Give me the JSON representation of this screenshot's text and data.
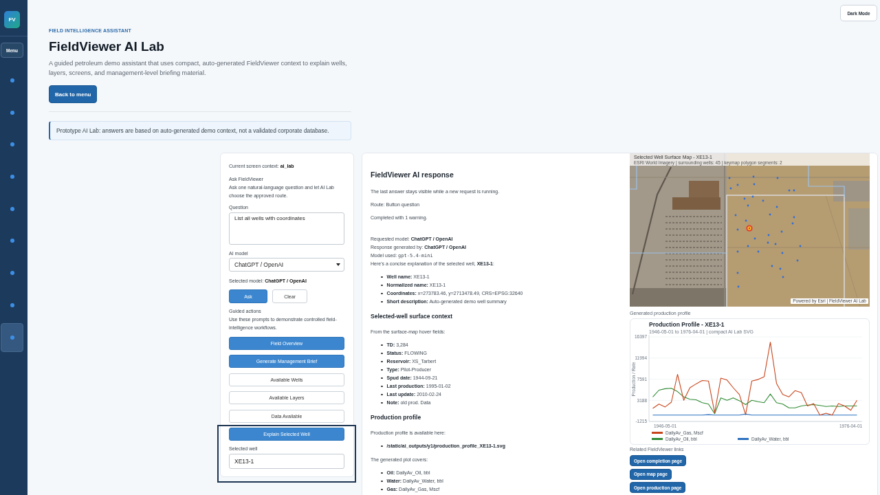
{
  "sidebar": {
    "logo": "FV",
    "menu_button": "Menu",
    "items": [
      {
        "selected": false
      },
      {
        "selected": false
      },
      {
        "selected": false
      },
      {
        "selected": false
      },
      {
        "selected": false
      },
      {
        "selected": false
      },
      {
        "selected": false
      },
      {
        "selected": false
      },
      {
        "selected": true
      }
    ]
  },
  "top_bar": {
    "dark_mode_button": "Dark Mode"
  },
  "header": {
    "kicker": "FIELD INTELLIGENCE ASSISTANT",
    "title": "FieldViewer AI Lab",
    "description": "A guided petroleum demo assistant that uses compact, auto-generated FieldViewer context to explain wells, layers, screens, and management-level briefing material.",
    "back_button": "Back to menu",
    "notice": "Prototype AI Lab: answers are based on auto-generated demo context, not a validated corporate database."
  },
  "ask_panel": {
    "context": "Current screen context: **ai_lab**",
    "heading": "Ask FieldViewer",
    "description": "Ask one natural-language question and let AI Lab choose the approved route.",
    "question": {
      "label": "Question",
      "value": "List all wells with coordinates"
    },
    "model": {
      "label": "AI model",
      "value": "ChatGPT / OpenAI"
    },
    "selected_model": "Selected model: **ChatGPT / OpenAI**",
    "buttons": [
      {
        "label": "Ask",
        "kind": "primary"
      },
      {
        "label": "Clear",
        "kind": "secondary"
      }
    ],
    "guided": {
      "heading": "Guided actions",
      "description": "Use these prompts to demonstrate controlled field-intelligence workflows.",
      "actions": [
        {
          "label": "Field Overview",
          "kind": "primary"
        },
        {
          "label": "Generate Management Brief",
          "kind": "primary"
        },
        {
          "label": "Available Wells",
          "kind": "secondary"
        },
        {
          "label": "Available Layers",
          "kind": "secondary"
        },
        {
          "label": "Data Available",
          "kind": "secondary"
        }
      ]
    },
    "focus_group": {
      "highlighted": true,
      "action": {
        "label": "Explain Selected Well",
        "kind": "primary"
      },
      "selected_well": {
        "label": "Selected well",
        "value": "XE13-1"
      }
    }
  },
  "response": {
    "title": "FieldViewer AI response",
    "status_lines": [
      "The last answer stays visible while a new request is running.",
      "Route: Button question",
      "Completed with 1 warning."
    ],
    "meta_lines": [
      "Requested model: **ChatGPT / OpenAI**",
      "Response generated by: **ChatGPT / OpenAI**"
    ],
    "model_used": {
      "label": "Model used:",
      "value": "gpt-5.4-mini"
    },
    "intro": "Here's a concise explanation of the selected well, **XE13-1**:",
    "well_facts": [
      "**Well name:** XE13-1",
      "**Normalized name:** XE13-1",
      "**Coordinates:** x=273783.46, y=2713478.49, CRS=EPSG:32640",
      "**Short description:** Auto-generated demo well summary"
    ],
    "sections": [
      {
        "heading": "Selected-well surface context",
        "blocks": [
          {
            "kind": "paragraph",
            "text": "From the surface-map hover fields:"
          },
          {
            "kind": "list",
            "items": [
              "**TD:** 3,284",
              "**Status:** FLOWING",
              "**Reservoir:** XS_Tarbert",
              "**Type:** Pilot-Producer",
              "**Spud date:** 1944-09-21",
              "**Last production:** 1995-01-02",
              "**Last update:** 2010-02-24",
              "**Note:** old prod. Data"
            ]
          }
        ]
      },
      {
        "heading": "Production profile",
        "blocks": [
          {
            "kind": "paragraph",
            "text": "Production profile is available here:"
          },
          {
            "kind": "list",
            "bold": true,
            "items": [
              "/static/ai_outputs/y1/production_profile_XE13-1.svg"
            ]
          },
          {
            "kind": "paragraph",
            "text": "The generated plot covers:"
          },
          {
            "kind": "list",
            "items": [
              "**Oil:** DailyAv_Oil, bbl",
              "**Water:** DailyAv_Water, bbl",
              "**Gas:** DailyAv_Gas, Mscf"
            ]
          }
        ]
      }
    ],
    "surface_map": {
      "title": "Selected Well Surface Map - XE13-1",
      "subtitle": "ESRI World Imagery | surrounding wells: 45 | keymap polygon segments: 2",
      "attribution": "Powered by Esri | FieldViewer AI Lab"
    },
    "production_profile": {
      "caption": "Generated production profile",
      "subtitle": "1946-05-01 to 1976-04-01 | compact AI Lab SVG",
      "chart_data": {
        "type": "line",
        "title": "Production Profile - XE13-1",
        "ylabel": "Production / Rate",
        "categories": [
          null,
          null,
          "1946-05-01",
          null,
          null,
          null,
          null,
          null,
          null,
          null,
          null,
          null,
          null,
          null,
          null,
          null,
          null,
          null,
          null,
          null,
          null,
          null,
          null,
          null,
          null,
          null,
          null,
          null,
          null,
          null,
          null,
          null,
          "1976-04-01",
          null
        ],
        "series": [
          {
            "name": "DailyAv_Gas, Mscf",
            "color": "#c8451c",
            "values": [
              1500,
              2400,
              1800,
              2800,
              8600,
              3200,
              5800,
              6600,
              7300,
              7200,
              600,
              7800,
              7400,
              5800,
              4400,
              200,
              7200,
              7500,
              8100,
              15300,
              6700,
              4400,
              3900,
              5200,
              4800,
              2000,
              2500,
              100,
              500,
              100,
              2500,
              2000,
              1100,
              3200
            ]
          },
          {
            "name": "DailyAv_Oil, bbl",
            "color": "#2e8a32",
            "values": [
              3900,
              5300,
              5600,
              5700,
              5000,
              3900,
              3400,
              3300,
              2700,
              2400,
              400,
              3700,
              3200,
              3700,
              3100,
              2300,
              3200,
              2900,
              2700,
              4500,
              2700,
              2400,
              1600,
              1600,
              2000,
              2200,
              2300,
              2100,
              1900,
              2000,
              1900,
              2000,
              2000,
              2000
            ]
          },
          {
            "name": "DailyAv_Water, bbl",
            "color": "#2a6fbf",
            "values": [
              100,
              100,
              100,
              100,
              100,
              100,
              100,
              100,
              100,
              200,
              100,
              100,
              100,
              100,
              100,
              300,
              100,
              100,
              100,
              100,
              100,
              100,
              100,
              100,
              100,
              100,
              100,
              100,
              100,
              100,
              100,
              100,
              100,
              100
            ]
          }
        ],
        "ylim": [
          -1215,
          16397
        ],
        "yticks": [
          -1215,
          3188,
          7591,
          11994,
          16397
        ],
        "grid": true,
        "legend": "bottom"
      }
    },
    "related_links": {
      "caption": "Related FieldViewer links",
      "buttons": [
        "Open completion page",
        "Open map page",
        "Open production page"
      ]
    }
  }
}
